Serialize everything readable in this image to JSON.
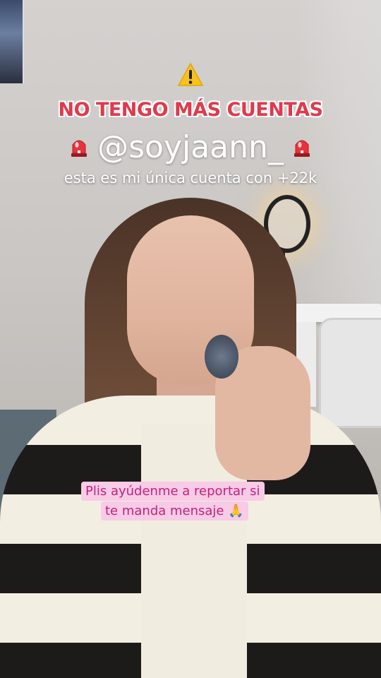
{
  "overlay": {
    "warning_icon": "warning-icon",
    "headline": "NO TENGO MÁS CUENTAS",
    "handle": "@soyjaann_",
    "siren_icon": "police-siren-icon",
    "subline": "esta es mi única cuenta con +22k"
  },
  "caption": {
    "line1": "Plis ayúdenme a reportar si",
    "line2": "te manda mensaje 🙏"
  },
  "colors": {
    "headline_red": "#e03a4c",
    "caption_bg": "#f8cbe6",
    "caption_text": "#c2227f"
  }
}
